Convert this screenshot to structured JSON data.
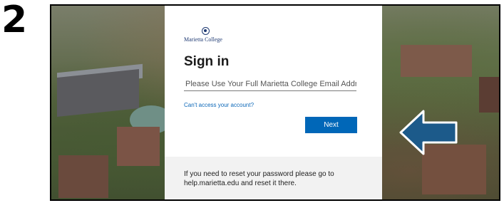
{
  "step": {
    "number": "2"
  },
  "login": {
    "brand": "Marietta College",
    "title": "Sign in",
    "email_placeholder": "Please Use Your Full Marietta College Email Address",
    "cant_access": "Can't access your account?",
    "next_label": "Next",
    "reset_line1": "If you need to reset your password please go to",
    "reset_line2": "help.marietta.edu and reset it there."
  },
  "colors": {
    "accent": "#0067b8",
    "link": "#0b67b8",
    "arrow_fill": "#1c5a8a",
    "footer_bg": "#f2f2f2"
  },
  "icons": {
    "logo": "college-seal-icon",
    "pointer": "left-arrow-icon"
  }
}
